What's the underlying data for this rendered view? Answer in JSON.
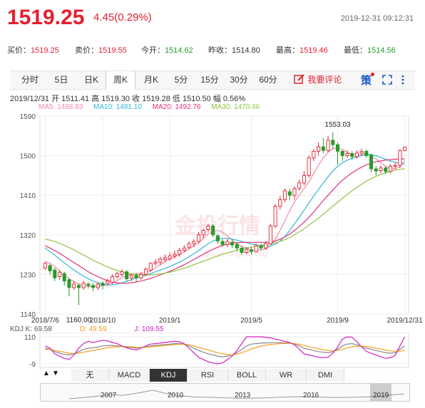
{
  "header": {
    "price": "1519.25",
    "change": "4.45(0.29%)",
    "datetime": "2019-12-31 09:12:31"
  },
  "quotes": [
    {
      "label": "买价：",
      "value": "1519.25",
      "color": "red"
    },
    {
      "label": "卖价：",
      "value": "1519.55",
      "color": "red"
    },
    {
      "label": "今开：",
      "value": "1514.62",
      "color": "green"
    },
    {
      "label": "昨收：",
      "value": "1514.80",
      "color": "gray"
    },
    {
      "label": "最高：",
      "value": "1519.46",
      "color": "red"
    },
    {
      "label": "最低：",
      "value": "1514.56",
      "color": "green"
    }
  ],
  "tabs": [
    "分时",
    "5日",
    "日K",
    "周K",
    "月K",
    "5分",
    "15分",
    "30分",
    "60分"
  ],
  "active_tab": "周K",
  "comment_label": "我要评论",
  "toolbar_icons": [
    "edit-icon",
    "strategy-icon",
    "fullscreen-icon",
    "more-icon"
  ],
  "strategy_label": "策",
  "info": "2019/12/31  开 1511.41  高 1519.30  收 1519.28  低 1510.50  幅 0.56%",
  "ma_legend": [
    {
      "text": "MA5: 1488.83",
      "color": "#f08aa8"
    },
    {
      "text": "MA10: 1481.10",
      "color": "#33b5d8"
    },
    {
      "text": "MA20: 1492.76",
      "color": "#e0307a"
    },
    {
      "text": "MA30: 1470.46",
      "color": "#8cc63f"
    }
  ],
  "kdj_legend": [
    {
      "text": "KDJ  K: 69.58",
      "color": "#555555"
    },
    {
      "text": "D: 49.59",
      "color": "#f0a020"
    },
    {
      "text": "J: 109.55",
      "color": "#d020c0"
    }
  ],
  "watermark": "金投行情",
  "watermark_sub": "quote.cngold.org",
  "bottom_tabs": [
    "无",
    "MACD",
    "KDJ",
    "RSI",
    "BOLL",
    "WR",
    "DMI"
  ],
  "active_bottom_tab": "KDJ",
  "nav_arrows": [
    "▲",
    "▼"
  ],
  "overview_years": [
    "2007",
    "2010",
    "2013",
    "2016",
    "2019"
  ],
  "colors": {
    "up": "#e4202f",
    "down": "#2a9a2a",
    "accent": "#e4202f"
  },
  "chart_data": {
    "type": "candlestick",
    "y_ticks": [
      "1590",
      "1500",
      "1410",
      "1320",
      "1230",
      "1140"
    ],
    "ylim": [
      1140,
      1590
    ],
    "x_labels": [
      "2018/7/6",
      "2018/10",
      "2019/1",
      "2019/5",
      "2019/9",
      "2019/12/31"
    ],
    "x_label_weeks": [
      0,
      12,
      26,
      43,
      61,
      75
    ],
    "annotations": [
      {
        "text": "1553.03",
        "week": 61,
        "value": 1553.03
      },
      {
        "text": "1160.00",
        "week": 7,
        "value": 1160.0
      }
    ],
    "candles": [
      [
        1245,
        1255,
        1240,
        1258
      ],
      [
        1250,
        1238,
        1230,
        1255
      ],
      [
        1240,
        1222,
        1215,
        1245
      ],
      [
        1225,
        1235,
        1218,
        1240
      ],
      [
        1232,
        1215,
        1205,
        1236
      ],
      [
        1218,
        1200,
        1180,
        1222
      ],
      [
        1200,
        1208,
        1195,
        1215
      ],
      [
        1205,
        1200,
        1160,
        1210
      ],
      [
        1200,
        1210,
        1195,
        1215
      ],
      [
        1208,
        1205,
        1198,
        1212
      ],
      [
        1205,
        1200,
        1192,
        1210
      ],
      [
        1200,
        1208,
        1195,
        1212
      ],
      [
        1210,
        1205,
        1196,
        1214
      ],
      [
        1210,
        1215,
        1205,
        1220
      ],
      [
        1212,
        1225,
        1208,
        1230
      ],
      [
        1225,
        1232,
        1220,
        1236
      ],
      [
        1230,
        1236,
        1225,
        1242
      ],
      [
        1236,
        1220,
        1215,
        1240
      ],
      [
        1222,
        1228,
        1215,
        1232
      ],
      [
        1228,
        1222,
        1212,
        1232
      ],
      [
        1222,
        1230,
        1218,
        1236
      ],
      [
        1230,
        1242,
        1226,
        1246
      ],
      [
        1240,
        1255,
        1236,
        1258
      ],
      [
        1255,
        1258,
        1250,
        1265
      ],
      [
        1258,
        1265,
        1252,
        1270
      ],
      [
        1264,
        1268,
        1258,
        1275
      ],
      [
        1266,
        1272,
        1262,
        1280
      ],
      [
        1272,
        1276,
        1266,
        1284
      ],
      [
        1276,
        1285,
        1270,
        1290
      ],
      [
        1285,
        1290,
        1280,
        1296
      ],
      [
        1292,
        1300,
        1288,
        1305
      ],
      [
        1300,
        1305,
        1292,
        1310
      ],
      [
        1305,
        1320,
        1300,
        1326
      ],
      [
        1320,
        1330,
        1312,
        1335
      ],
      [
        1332,
        1340,
        1328,
        1345
      ],
      [
        1340,
        1320,
        1315,
        1344
      ],
      [
        1318,
        1306,
        1300,
        1322
      ],
      [
        1305,
        1298,
        1292,
        1310
      ],
      [
        1298,
        1305,
        1292,
        1312
      ],
      [
        1303,
        1297,
        1290,
        1310
      ],
      [
        1298,
        1290,
        1282,
        1304
      ],
      [
        1290,
        1280,
        1274,
        1295
      ],
      [
        1280,
        1287,
        1276,
        1292
      ],
      [
        1286,
        1282,
        1275,
        1292
      ],
      [
        1282,
        1295,
        1280,
        1300
      ],
      [
        1295,
        1290,
        1284,
        1300
      ],
      [
        1290,
        1300,
        1286,
        1305
      ],
      [
        1300,
        1340,
        1298,
        1345
      ],
      [
        1340,
        1385,
        1335,
        1390
      ],
      [
        1385,
        1400,
        1378,
        1408
      ],
      [
        1400,
        1420,
        1394,
        1425
      ],
      [
        1418,
        1410,
        1398,
        1425
      ],
      [
        1410,
        1425,
        1400,
        1430
      ],
      [
        1426,
        1438,
        1420,
        1445
      ],
      [
        1438,
        1455,
        1432,
        1465
      ],
      [
        1455,
        1495,
        1450,
        1500
      ],
      [
        1495,
        1510,
        1488,
        1515
      ],
      [
        1510,
        1520,
        1500,
        1530
      ],
      [
        1520,
        1512,
        1505,
        1540
      ],
      [
        1512,
        1535,
        1508,
        1545
      ],
      [
        1535,
        1525,
        1515,
        1553.03
      ],
      [
        1525,
        1510,
        1480,
        1530
      ],
      [
        1510,
        1500,
        1488,
        1512
      ],
      [
        1500,
        1505,
        1495,
        1512
      ],
      [
        1505,
        1498,
        1490,
        1510
      ],
      [
        1498,
        1506,
        1493,
        1512
      ],
      [
        1506,
        1510,
        1500,
        1516
      ],
      [
        1510,
        1500,
        1495,
        1514
      ],
      [
        1502,
        1470,
        1462,
        1505
      ],
      [
        1470,
        1465,
        1455,
        1476
      ],
      [
        1466,
        1472,
        1460,
        1478
      ],
      [
        1472,
        1464,
        1458,
        1476
      ],
      [
        1464,
        1476,
        1460,
        1481
      ],
      [
        1476,
        1478,
        1470,
        1484
      ],
      [
        1478,
        1511,
        1472,
        1515
      ],
      [
        1511.41,
        1519.28,
        1510.5,
        1519.3
      ]
    ],
    "series": [
      {
        "name": "MA5",
        "color": "#f08aa8",
        "values": [
          1260,
          1255,
          1248,
          1238,
          1228,
          1220,
          1214,
          1208,
          1205,
          1203,
          1203,
          1204,
          1205,
          1206,
          1210,
          1216,
          1222,
          1228,
          1230,
          1232,
          1232,
          1234,
          1238,
          1245,
          1252,
          1259,
          1265,
          1270,
          1275,
          1281,
          1288,
          1295,
          1302,
          1312,
          1322,
          1328,
          1330,
          1326,
          1318,
          1308,
          1300,
          1294,
          1290,
          1286,
          1285,
          1286,
          1288,
          1295,
          1310,
          1330,
          1352,
          1375,
          1395,
          1410,
          1425,
          1440,
          1460,
          1478,
          1495,
          1508,
          1515,
          1518,
          1514,
          1508,
          1503,
          1500,
          1503,
          1505,
          1500,
          1492,
          1484,
          1476,
          1470,
          1470,
          1475,
          1488.83
        ]
      },
      {
        "name": "MA10",
        "color": "#33b5d8",
        "values": [
          1290,
          1282,
          1274,
          1265,
          1256,
          1248,
          1240,
          1233,
          1226,
          1220,
          1215,
          1211,
          1208,
          1206,
          1206,
          1208,
          1211,
          1214,
          1218,
          1222,
          1225,
          1228,
          1232,
          1236,
          1240,
          1244,
          1248,
          1253,
          1258,
          1263,
          1270,
          1277,
          1284,
          1292,
          1300,
          1306,
          1310,
          1312,
          1312,
          1310,
          1308,
          1305,
          1302,
          1299,
          1297,
          1295,
          1294,
          1295,
          1299,
          1306,
          1316,
          1330,
          1345,
          1360,
          1376,
          1392,
          1408,
          1423,
          1438,
          1452,
          1465,
          1476,
          1484,
          1490,
          1494,
          1497,
          1500,
          1502,
          1502,
          1500,
          1496,
          1492,
          1488,
          1485,
          1482,
          1481.1
        ]
      },
      {
        "name": "MA20",
        "color": "#e0307a",
        "values": [
          1295,
          1290,
          1284,
          1278,
          1271,
          1264,
          1257,
          1250,
          1243,
          1236,
          1230,
          1225,
          1220,
          1216,
          1213,
          1211,
          1210,
          1210,
          1211,
          1213,
          1215,
          1218,
          1221,
          1225,
          1229,
          1233,
          1237,
          1242,
          1247,
          1252,
          1258,
          1264,
          1270,
          1276,
          1282,
          1287,
          1292,
          1296,
          1299,
          1301,
          1302,
          1303,
          1303,
          1303,
          1303,
          1303,
          1303,
          1304,
          1306,
          1310,
          1315,
          1322,
          1330,
          1339,
          1349,
          1360,
          1372,
          1385,
          1398,
          1410,
          1422,
          1434,
          1444,
          1453,
          1461,
          1468,
          1474,
          1479,
          1483,
          1486,
          1488,
          1490,
          1491,
          1492,
          1492.5,
          1492.76
        ]
      },
      {
        "name": "MA30",
        "color": "#8cc63f",
        "values": [
          1310,
          1308,
          1305,
          1301,
          1296,
          1291,
          1286,
          1280,
          1274,
          1268,
          1262,
          1257,
          1252,
          1247,
          1243,
          1239,
          1236,
          1233,
          1231,
          1230,
          1229,
          1229,
          1229,
          1230,
          1231,
          1233,
          1235,
          1238,
          1241,
          1244,
          1248,
          1252,
          1256,
          1260,
          1264,
          1268,
          1272,
          1276,
          1279,
          1282,
          1285,
          1288,
          1290,
          1292,
          1294,
          1296,
          1298,
          1300,
          1302,
          1305,
          1309,
          1314,
          1320,
          1327,
          1334,
          1342,
          1350,
          1358,
          1367,
          1376,
          1385,
          1394,
          1403,
          1412,
          1420,
          1428,
          1435,
          1442,
          1448,
          1453,
          1457,
          1461,
          1464,
          1467,
          1469,
          1470.46
        ]
      }
    ],
    "kdj": {
      "ylim": [
        -9,
        110
      ],
      "y_ticks": [
        "110",
        "-9"
      ],
      "K": [
        60,
        55,
        45,
        38,
        32,
        30,
        35,
        45,
        55,
        60,
        62,
        65,
        70,
        72,
        72,
        70,
        68,
        65,
        62,
        60,
        62,
        66,
        70,
        72,
        74,
        76,
        78,
        80,
        80,
        78,
        70,
        60,
        50,
        42,
        35,
        30,
        25,
        22,
        25,
        30,
        40,
        55,
        70,
        78,
        80,
        82,
        83,
        84,
        84,
        84,
        83,
        82,
        78,
        70,
        60,
        55,
        50,
        45,
        42,
        40,
        45,
        55,
        70,
        78,
        80,
        75,
        68,
        60,
        55,
        50,
        45,
        40,
        38,
        40,
        55,
        69.58
      ],
      "D": [
        55,
        54,
        50,
        46,
        42,
        38,
        36,
        38,
        42,
        46,
        50,
        54,
        58,
        62,
        65,
        66,
        67,
        67,
        66,
        64,
        63,
        64,
        66,
        68,
        70,
        72,
        74,
        76,
        77,
        77,
        75,
        70,
        64,
        58,
        52,
        46,
        40,
        35,
        32,
        31,
        34,
        40,
        48,
        56,
        63,
        69,
        73,
        76,
        78,
        80,
        81,
        81,
        80,
        77,
        72,
        67,
        62,
        57,
        53,
        50,
        48,
        50,
        55,
        61,
        66,
        69,
        69,
        67,
        64,
        60,
        56,
        52,
        48,
        46,
        47,
        49.59
      ],
      "J": [
        70,
        60,
        35,
        25,
        15,
        10,
        30,
        60,
        80,
        90,
        85,
        90,
        95,
        92,
        85,
        80,
        70,
        62,
        55,
        52,
        60,
        70,
        78,
        80,
        82,
        85,
        88,
        90,
        88,
        80,
        60,
        40,
        20,
        10,
        0,
        -5,
        -9,
        -5,
        10,
        25,
        50,
        80,
        110,
        110,
        110,
        110,
        108,
        105,
        100,
        95,
        90,
        85,
        75,
        55,
        35,
        30,
        25,
        20,
        18,
        20,
        38,
        65,
        100,
        110,
        108,
        88,
        66,
        46,
        37,
        30,
        22,
        15,
        18,
        28,
        70,
        109.55
      ]
    },
    "overview": [
      1200,
      1260,
      1320,
      1400,
      1500,
      1420,
      1520,
      1650,
      1780,
      1600,
      1450,
      1380,
      1320,
      1310,
      1290,
      1260,
      1240,
      1230,
      1250,
      1270,
      1300,
      1320,
      1340,
      1330,
      1310,
      1290,
      1280,
      1300,
      1320,
      1340,
      1400,
      1480,
      1520
    ]
  }
}
